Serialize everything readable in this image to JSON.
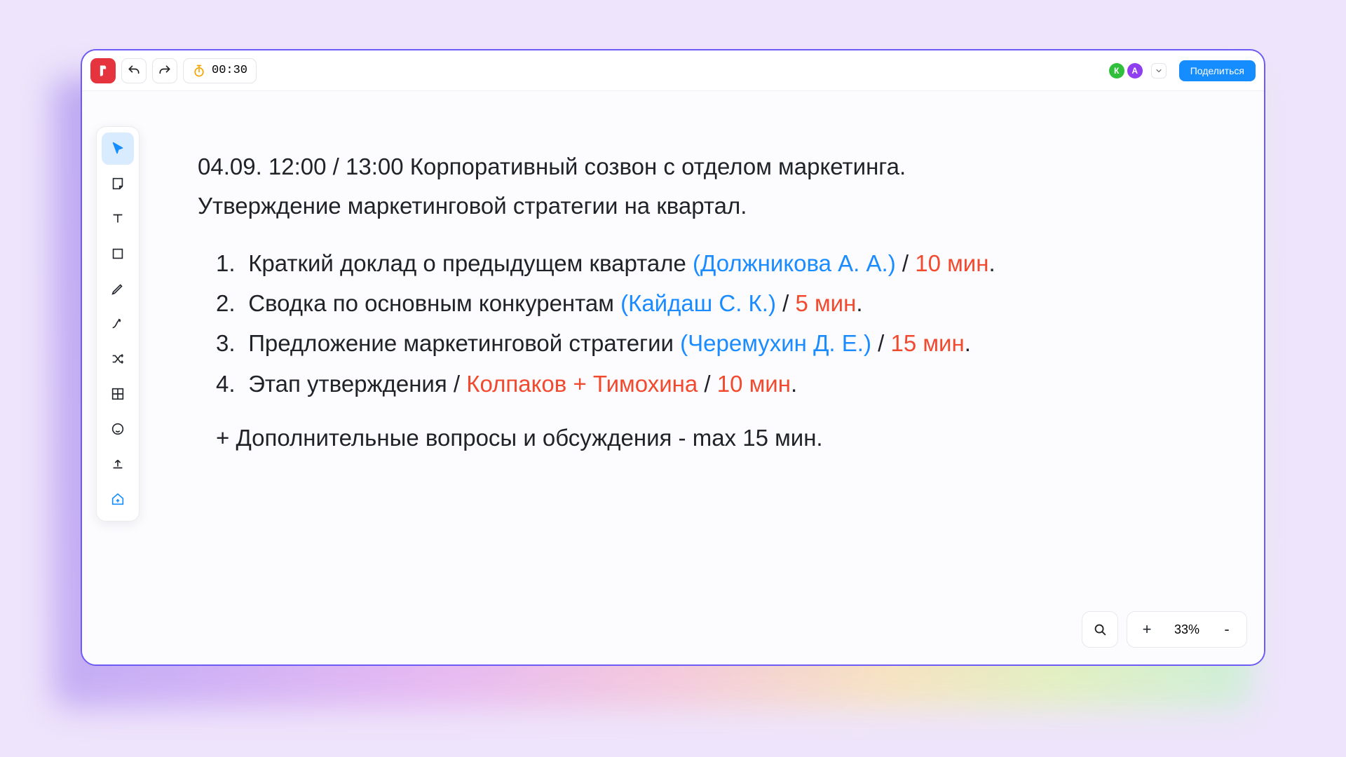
{
  "topbar": {
    "timer": "00:30",
    "avatars": [
      "К",
      "А"
    ],
    "share_label": "Поделиться"
  },
  "zoom": {
    "plus": "+",
    "level": "33%",
    "minus": "-"
  },
  "doc": {
    "heading_l1": "04.09. 12:00 / 13:00 Корпоративный созвон с отделом маркетинга.",
    "heading_l2": "Утверждение маркетинговой стратегии на квартал.",
    "items": [
      {
        "num": "1.",
        "text": "Краткий доклад о предыдущем квартале ",
        "paren_open": "(",
        "person": "Должникова А. А.",
        "paren_close": ")",
        "sep": " / ",
        "dur": "10 мин",
        "dot": "."
      },
      {
        "num": "2.",
        "text": "Сводка по основным конкурентам ",
        "paren_open": "(",
        "person": "Кайдаш С. К.",
        "paren_close": ")",
        "sep": " / ",
        "dur": "5 мин",
        "dot": "."
      },
      {
        "num": "3.",
        "text": "Предложение маркетинговой стратегии ",
        "paren_open": "(",
        "person": "Черемухин Д. Е.",
        "paren_close": ")",
        "sep": " / ",
        "dur": "15 мин",
        "dot": "."
      },
      {
        "num": "4.",
        "text": "Этап утверждения / ",
        "people_red": "Колпаков + Тимохина",
        "sep": " / ",
        "dur": "10 мин",
        "dot": "."
      }
    ],
    "extras": "+ Дополнительные вопросы и обсуждения - max 15 мин."
  }
}
